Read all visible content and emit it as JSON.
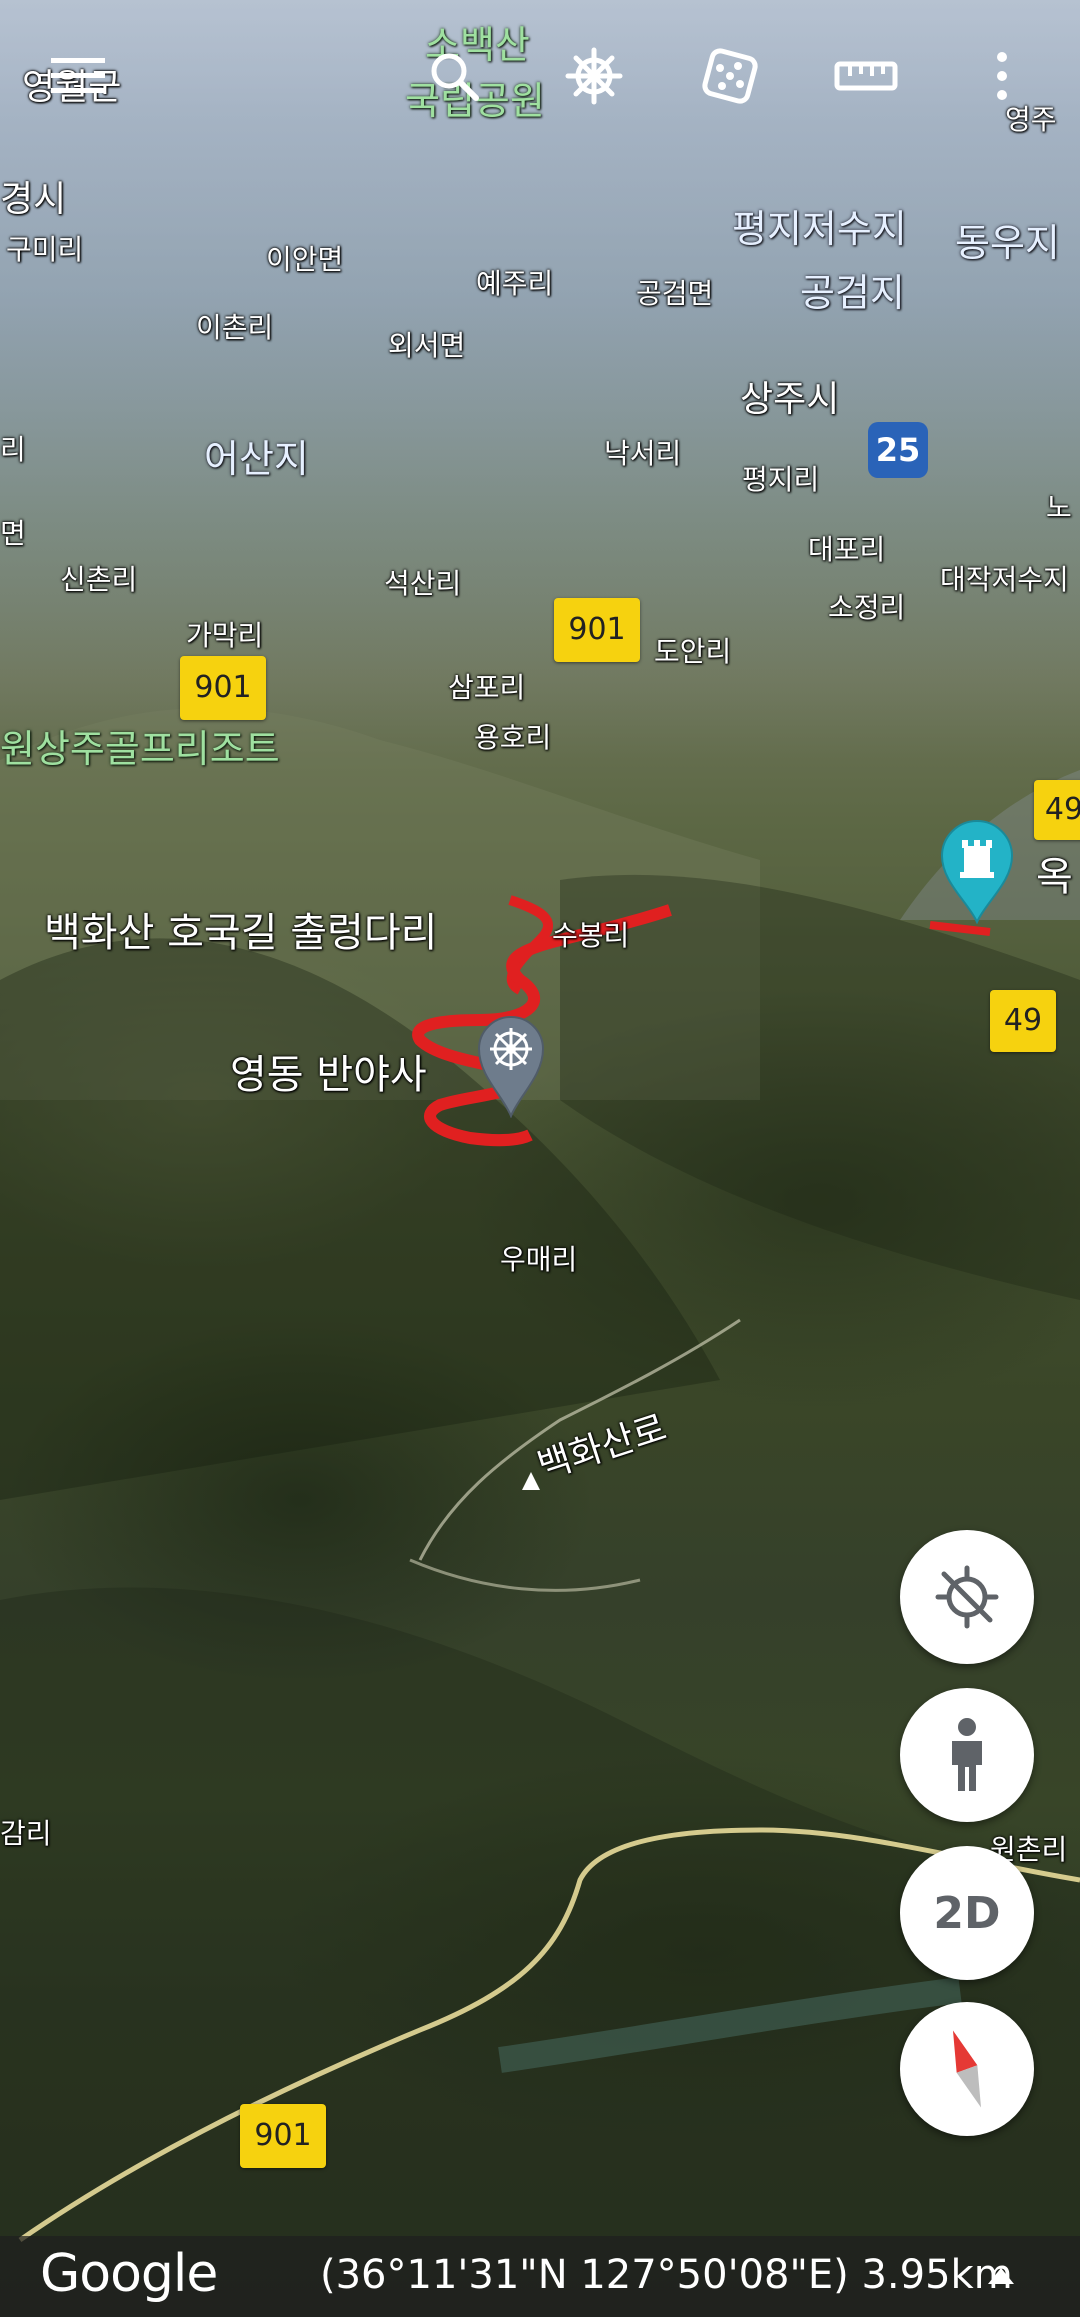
{
  "map": {
    "place_labels": [
      {
        "text": "영월군",
        "cls": "md"
      },
      {
        "text": "소백산",
        "cls": "green"
      },
      {
        "text": "국립공원",
        "cls": "green"
      },
      {
        "text": "영주",
        "cls": "md"
      },
      {
        "text": "경시",
        "cls": "md"
      },
      {
        "text": "구미리",
        "cls": "sm"
      },
      {
        "text": "이안면",
        "cls": "sm"
      },
      {
        "text": "예주리",
        "cls": "sm"
      },
      {
        "text": "공검면",
        "cls": "sm"
      },
      {
        "text": "평지저수지",
        "cls": "blue"
      },
      {
        "text": "동우지",
        "cls": "blue"
      },
      {
        "text": "공검지",
        "cls": "blue"
      },
      {
        "text": "이촌리",
        "cls": "sm"
      },
      {
        "text": "외서면",
        "cls": "sm"
      },
      {
        "text": "상주시",
        "cls": "md"
      },
      {
        "text": "어산지",
        "cls": "blue"
      },
      {
        "text": "낙서리",
        "cls": "sm"
      },
      {
        "text": "평지리",
        "cls": "sm"
      },
      {
        "text": "노",
        "cls": "sm"
      },
      {
        "text": "리",
        "cls": "sm"
      },
      {
        "text": "면",
        "cls": "sm"
      },
      {
        "text": "신촌리",
        "cls": "sm"
      },
      {
        "text": "석산리",
        "cls": "sm"
      },
      {
        "text": "대포리",
        "cls": "sm"
      },
      {
        "text": "대작저수지",
        "cls": "sm"
      },
      {
        "text": "소정리",
        "cls": "sm"
      },
      {
        "text": "가막리",
        "cls": "sm"
      },
      {
        "text": "도안리",
        "cls": "sm"
      },
      {
        "text": "삼포리",
        "cls": "sm"
      },
      {
        "text": "용호리",
        "cls": "sm"
      },
      {
        "text": "원상주골프리조트",
        "cls": "green"
      },
      {
        "text": "옥",
        "cls": "lg"
      },
      {
        "text": "백화산 호국길 출렁다리",
        "cls": "lg"
      },
      {
        "text": "수봉리",
        "cls": "sm"
      },
      {
        "text": "영동 반야사",
        "cls": "lg"
      },
      {
        "text": "우매리",
        "cls": "sm"
      },
      {
        "text": "백화산로",
        "cls": "md"
      },
      {
        "text": "감리",
        "cls": "sm"
      },
      {
        "text": "원촌리",
        "cls": "sm"
      }
    ],
    "route_shields": [
      "901",
      "901",
      "49",
      "49",
      "901"
    ],
    "national_route": "25"
  },
  "topbar": {
    "icons": [
      "menu-icon",
      "search-icon",
      "voyager-icon",
      "feeling-lucky-icon",
      "measure-icon",
      "more-options-icon"
    ]
  },
  "controls": {
    "two_d_label": "2D"
  },
  "bottombar": {
    "google_logo": "Google",
    "coords": "(36°11'31\"N 127°50'08\"E) 3.95km"
  }
}
